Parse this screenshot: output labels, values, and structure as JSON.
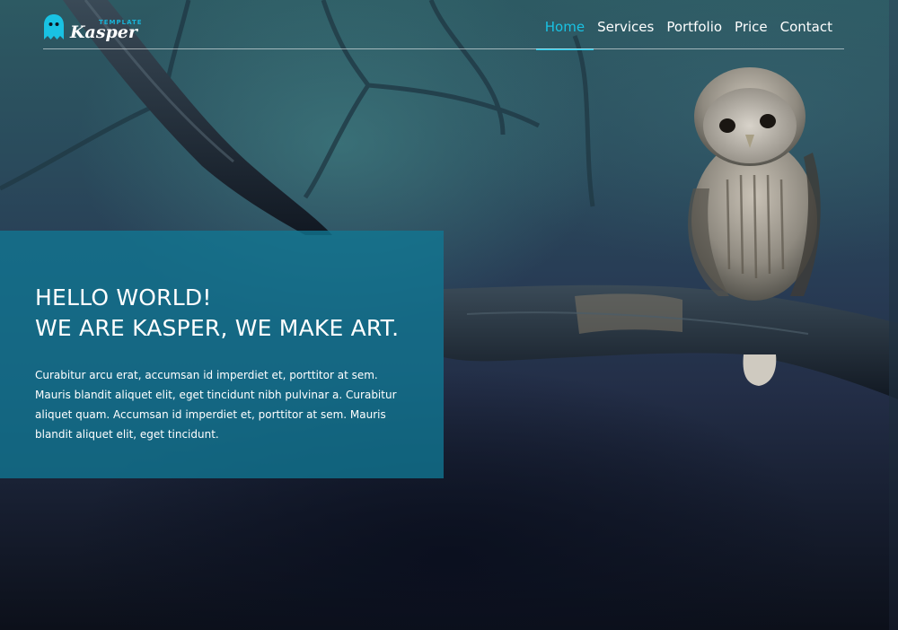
{
  "brand": {
    "logo_main": "Kasper",
    "logo_sub": "TEMPLATE"
  },
  "nav": {
    "items": [
      {
        "label": "Home",
        "active": true
      },
      {
        "label": "Services",
        "active": false
      },
      {
        "label": "Portfolio",
        "active": false
      },
      {
        "label": "Price",
        "active": false
      },
      {
        "label": "Contact",
        "active": false
      }
    ]
  },
  "intro": {
    "heading_line1": "HELLO WORLD!",
    "heading_line2": "WE ARE KASPER, WE MAKE ART.",
    "paragraph": "Curabitur arcu erat, accumsan id imperdiet et, porttitor at sem. Mauris blandit aliquet elit, eget tincidunt nibh pulvinar a. Curabitur aliquet quam. Accumsan id imperdiet et, porttitor at sem. Mauris blandit aliquet elit, eget tincidunt."
  },
  "colors": {
    "accent": "#19c2e3",
    "intro_box": "#117794"
  }
}
